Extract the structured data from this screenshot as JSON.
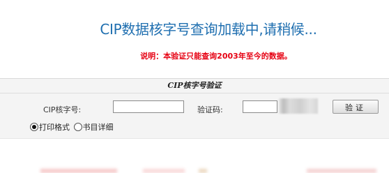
{
  "loading": {
    "title": "CIP数据核字号查询加载中,请稍候...",
    "note": "说明：本验证只能查询2003年至今的数据。"
  },
  "form": {
    "header": "CIP核字号验证",
    "cip_label": "CIP核字号:",
    "cip_value": "",
    "code_label": "验证码:",
    "code_value": "",
    "verify_button": "验证"
  },
  "format_options": [
    {
      "label": "打印格式",
      "selected": true
    },
    {
      "label": "书目详细",
      "selected": false
    }
  ],
  "colors": {
    "title": "#1f6fb0",
    "note": "#e60012",
    "panel_bg": "#f4f4f4"
  }
}
